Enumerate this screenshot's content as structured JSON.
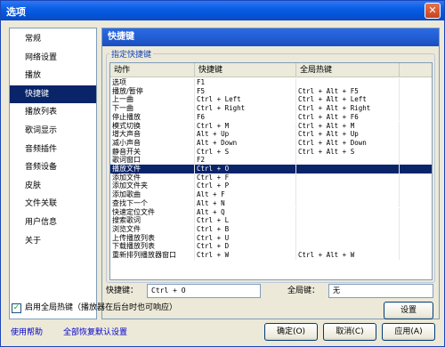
{
  "window": {
    "title": "选项",
    "close_glyph": "✕"
  },
  "sidebar": {
    "items": [
      {
        "label": "常规"
      },
      {
        "label": "网络设置"
      },
      {
        "label": "播放"
      },
      {
        "label": "快捷键"
      },
      {
        "label": "播放列表"
      },
      {
        "label": "歌词显示"
      },
      {
        "label": "音频插件"
      },
      {
        "label": "音频设备"
      },
      {
        "label": "皮肤"
      },
      {
        "label": "文件关联"
      },
      {
        "label": "用户信息"
      },
      {
        "label": "关于"
      }
    ],
    "selected_index": 3
  },
  "panel": {
    "title": "快捷键",
    "group_label": "指定快捷键"
  },
  "table": {
    "headers": [
      "动作",
      "快捷键",
      "全局热键"
    ],
    "rows": [
      {
        "action": "选项",
        "key": "F1",
        "global": ""
      },
      {
        "action": "播放/暂停",
        "key": "F5",
        "global": "Ctrl + Alt + F5"
      },
      {
        "action": "上一曲",
        "key": "Ctrl + Left",
        "global": "Ctrl + Alt + Left"
      },
      {
        "action": "下一曲",
        "key": "Ctrl + Right",
        "global": "Ctrl + Alt + Right"
      },
      {
        "action": "停止播放",
        "key": "F6",
        "global": "Ctrl + Alt + F6"
      },
      {
        "action": "模式切换",
        "key": "Ctrl + M",
        "global": "Ctrl + Alt + M"
      },
      {
        "action": "增大声音",
        "key": "Alt + Up",
        "global": "Ctrl + Alt + Up"
      },
      {
        "action": "减小声音",
        "key": "Alt + Down",
        "global": "Ctrl + Alt + Down"
      },
      {
        "action": "静音开关",
        "key": "Ctrl + S",
        "global": "Ctrl + Alt + S"
      },
      {
        "action": "歌词窗口",
        "key": "F2",
        "global": ""
      },
      {
        "action": "播放文件",
        "key": "Ctrl + O",
        "global": ""
      },
      {
        "action": "添加文件",
        "key": "Ctrl + F",
        "global": ""
      },
      {
        "action": "添加文件夹",
        "key": "Ctrl + P",
        "global": ""
      },
      {
        "action": "添加歌曲",
        "key": "Alt + F",
        "global": ""
      },
      {
        "action": "查找下一个",
        "key": "Alt + N",
        "global": ""
      },
      {
        "action": "快速定位文件",
        "key": "Alt + Q",
        "global": ""
      },
      {
        "action": "搜索歌词",
        "key": "Ctrl + L",
        "global": ""
      },
      {
        "action": "浏览文件",
        "key": "Ctrl + B",
        "global": ""
      },
      {
        "action": "上传播放列表",
        "key": "Ctrl + U",
        "global": ""
      },
      {
        "action": "下载播放列表",
        "key": "Ctrl + D",
        "global": ""
      },
      {
        "action": "重新排列播放器窗口",
        "key": "Ctrl + W",
        "global": "Ctrl + Alt + W"
      }
    ],
    "selected_index": 10
  },
  "shortcut": {
    "label": "快捷键：",
    "value": "Ctrl + O"
  },
  "hotkey": {
    "label": "全局键：",
    "value": "无"
  },
  "checkbox": {
    "label": "启用全局热键（播放器在后台时也可响应）",
    "checked": true,
    "mark": "✓"
  },
  "buttons": {
    "set": "设置",
    "ok": "确定(O)",
    "cancel": "取消(C)",
    "apply": "应用(A)"
  },
  "links": {
    "help": "使用帮助",
    "restore": "全部恢复默认设置"
  },
  "colors": {
    "title_blue": "#0a5ee6",
    "selection": "#0a246a",
    "link": "#0000cc"
  }
}
